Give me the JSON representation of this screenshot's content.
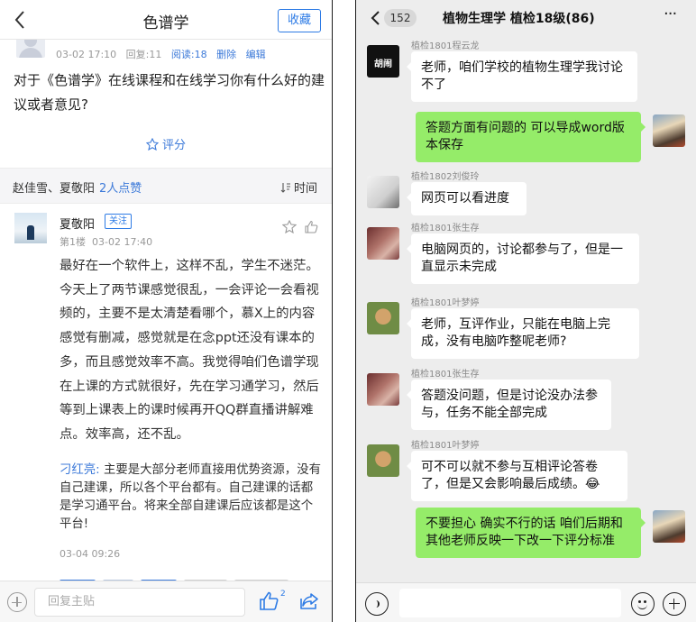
{
  "forum": {
    "header": {
      "title": "色谱学",
      "favorite_label": "收藏"
    },
    "post": {
      "date": "03-02 17:10",
      "reply_count": "回复:11",
      "read_count": "阅读:18",
      "delete_label": "删除",
      "edit_label": "编辑",
      "title": "对于《色谱学》在线课程和在线学习你有什么好的建议或者意见?",
      "rate_label": "评分"
    },
    "likes": {
      "names": "赵佳雪、夏敬阳",
      "count_label": "2人点赞",
      "sort_label": "时间"
    },
    "comment": {
      "author": "夏敬阳",
      "follow_label": "关注",
      "floor": "第1楼",
      "date": "03-02 17:40",
      "body": "最好在一个软件上，这样不乱，学生不迷茫。今天上了两节课感觉很乱，一会评论一会看视频的，主要不是太清楚看哪个，慕X上的内容感觉有删减，感觉就是在念ppt还没有课本的多，而且感觉效率不高。我觉得咱们色谱学现在上课的方式就很好，先在学习通学习，然后等到上课表上的课时候再开QQ群直播讲解难点。效率高，还不乱。",
      "reply_author": "刁红亮:",
      "reply_text": " 主要是大部分老师直接用优势资源，没有自己建课，所以各个平台都有。自己建课的话都是学习通平台。将来全部自建课后应该都是这个平台!",
      "reply_time": "03-04 09:26"
    },
    "bottom": {
      "reply_placeholder": "回复主贴",
      "like_count": "2"
    }
  },
  "chat": {
    "header": {
      "unread": "152",
      "title": "植物生理学 植检18级(86)",
      "more": "···"
    },
    "messages": [
      {
        "sender": "植检1801程云龙",
        "text": "老师，咱们学校的植物生理学我讨论不了",
        "avatar_text": "胡闹"
      },
      {
        "sender": "",
        "text": "答题方面有问题的 可以导成word版本保存"
      },
      {
        "sender": "植检1802刘俊玲",
        "text": "网页可以看进度"
      },
      {
        "sender": "植检1801张生存",
        "text": "电脑网页的，讨论都参与了，但是一直显示未完成"
      },
      {
        "sender": "植检1801叶梦婷",
        "text": "老师，互评作业，只能在电脑上完成，没有电脑咋整呢老师?"
      },
      {
        "sender": "植检1801张生存",
        "text": "答题没问题，但是讨论没办法参与，任务不能全部完成"
      },
      {
        "sender": "植检1801叶梦婷",
        "text": "可不可以就不参与互相评论答卷了，但是又会影响最后成绩。😂"
      },
      {
        "sender": "",
        "text": "不要担心 确实不行的话 咱们后期和其他老师反映一下改一下评分标准"
      }
    ]
  },
  "colors": {
    "accent_blue": "#2d7be5",
    "wechat_green": "#95ec69",
    "chat_bg": "#ededed"
  }
}
